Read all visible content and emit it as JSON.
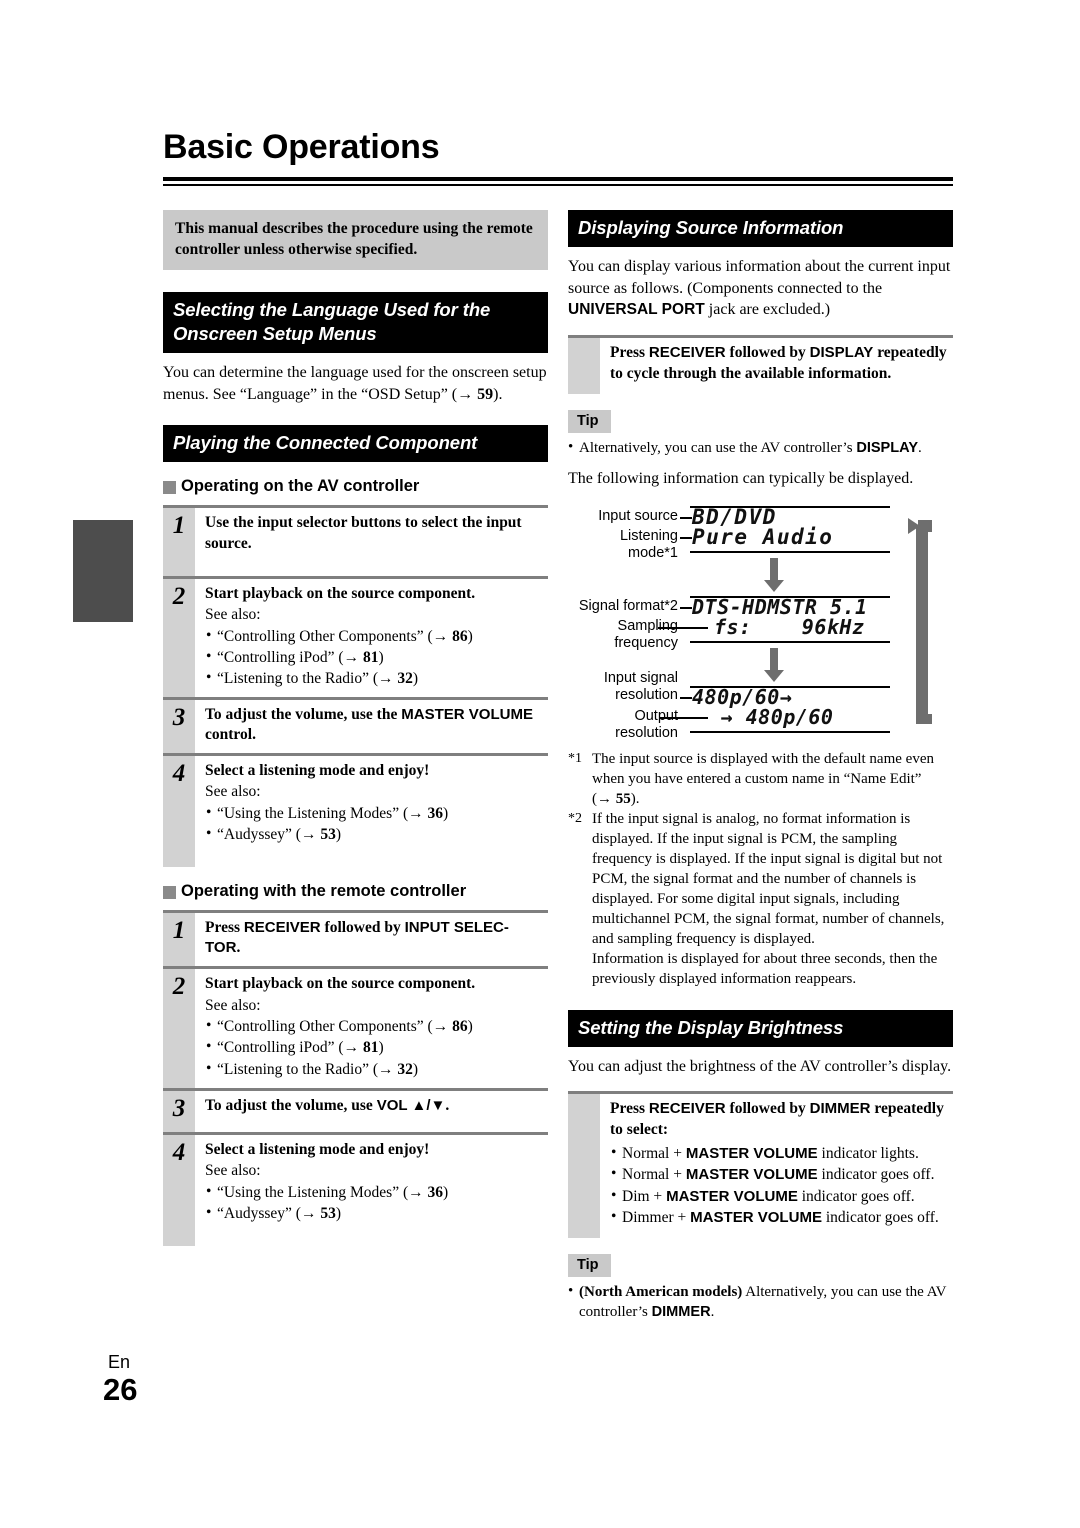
{
  "page": {
    "title": "Basic Operations",
    "language_code": "En",
    "page_number": "26"
  },
  "left_column": {
    "manual_note": "This manual describes the procedure using the remote controller unless otherwise specified.",
    "section_language": {
      "heading": "Selecting the Language Used for the Onscreen Setup Menus",
      "body": "You can determine the language used for the onscreen setup menus. See “Language” in the “OSD Setup” (→ 59)."
    },
    "section_playing": {
      "heading": "Playing the Connected Component",
      "sub_av_controller": "Operating on the AV controller",
      "sub_remote": "Operating with the remote controller",
      "av_steps": [
        {
          "num": "1",
          "title": "Use the input selector buttons to select the input source.",
          "see_also": "",
          "items": []
        },
        {
          "num": "2",
          "title": "Start playback on the source component.",
          "see_also": "See also:",
          "items": [
            "“Controlling Other Components” (→ 86)",
            "“Controlling iPod” (→ 81)",
            "“Listening to the Radio” (→ 32)"
          ]
        },
        {
          "num": "3",
          "title": "To adjust the volume, use the MASTER VOLUME control.",
          "see_also": "",
          "items": []
        },
        {
          "num": "4",
          "title": "Select a listening mode and enjoy!",
          "see_also": "See also:",
          "items": [
            "“Using the Listening Modes” (→ 36)",
            "“Audyssey” (→ 53)"
          ]
        }
      ],
      "remote_steps": [
        {
          "num": "1",
          "title": "Press RECEIVER followed by INPUT SELECTOR.",
          "see_also": "",
          "items": []
        },
        {
          "num": "2",
          "title": "Start playback on the source component.",
          "see_also": "See also:",
          "items": [
            "“Controlling Other Components” (→ 86)",
            "“Controlling iPod” (→ 81)",
            "“Listening to the Radio” (→ 32)"
          ]
        },
        {
          "num": "3",
          "title": "To adjust the volume, use VOL ▲/▼.",
          "see_also": "",
          "items": []
        },
        {
          "num": "4",
          "title": "Select a listening mode and enjoy!",
          "see_also": "See also:",
          "items": [
            "“Using the Listening Modes” (→ 36)",
            "“Audyssey” (→ 53)"
          ]
        }
      ]
    }
  },
  "right_column": {
    "section_source_info": {
      "heading": "Displaying Source Information",
      "body": "You can display various information about the current input source as follows. (Components connected to the UNIVERSAL PORT jack are excluded.)",
      "instruction": "Press RECEIVER followed by DISPLAY repeatedly to cycle through the available information.",
      "tip_label": "Tip",
      "tip_text": "Alternatively, you can use the AV controller’s DISPLAY.",
      "intro_list": "The following information can typically be displayed.",
      "diagram": {
        "labels": {
          "input_source": "Input source",
          "listening_mode": "Listening\nmode*1",
          "signal_format": "Signal format*2",
          "sampling_frequency": "Sampling\nfrequency",
          "input_resolution": "Input signal\nresolution",
          "output_resolution": "Output\nresolution"
        },
        "screens": [
          {
            "line1": "BD/DVD",
            "line2": "Pure Audio"
          },
          {
            "line1": "DTS-HDMSTR 5.1",
            "line2": "fs:    96kHz"
          },
          {
            "line1": "480p/60→",
            "line2": " → 480p/60"
          }
        ]
      },
      "footnotes": [
        {
          "mark": "*1",
          "text": "The input source is displayed with the default name even when you have entered a custom name in “Name Edit” (→ 55)."
        },
        {
          "mark": "*2",
          "text": "If the input signal is analog, no format information is displayed. If the input signal is PCM, the sampling frequency is displayed. If the input signal is digital but not PCM, the signal format and the number of channels is displayed. For some digital input signals, including multichannel PCM, the signal format, number of channels, and sampling frequency is displayed."
        }
      ],
      "footnote_extra": "Information is displayed for about three seconds, then the previously displayed information reappears."
    },
    "section_brightness": {
      "heading": "Setting the Display Brightness",
      "body": "You can adjust the brightness of the AV controller’s display.",
      "instruction": "Press RECEIVER followed by DIMMER repeatedly to select:",
      "options": [
        "Normal + MASTER VOLUME indicator lights.",
        "Normal + MASTER VOLUME indicator goes off.",
        "Dim + MASTER VOLUME indicator goes off.",
        "Dimmer + MASTER VOLUME indicator goes off."
      ],
      "tip_label": "Tip",
      "tip_text": "(North American models) Alternatively, you can use the AV controller’s DIMMER."
    }
  },
  "colors": {
    "heading_bar_bg": "#000000",
    "note_bg": "#c9c9c9",
    "step_num_bg": "#d2d2d2",
    "rule": "#7f7f7f",
    "thumb_tab": "#4d4d4d"
  }
}
